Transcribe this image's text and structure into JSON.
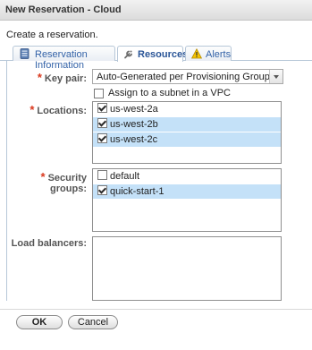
{
  "window": {
    "title": "New Reservation - Cloud"
  },
  "description": "Create a reservation.",
  "tabs": [
    {
      "label": "Reservation Information",
      "icon": "document-icon"
    },
    {
      "label": "Resources",
      "icon": "wrench-icon"
    },
    {
      "label": "Alerts",
      "icon": "warning-icon"
    }
  ],
  "active_tab": "Resources",
  "required_marker": "*",
  "form": {
    "key_pair": {
      "label": "Key pair:",
      "value": "Auto-Generated per Provisioning Group"
    },
    "subnet": {
      "label": "Assign to a subnet in a VPC",
      "checked": false
    },
    "locations": {
      "label": "Locations:",
      "items": [
        {
          "label": "us-west-2a",
          "checked": true,
          "selected": false
        },
        {
          "label": "us-west-2b",
          "checked": true,
          "selected": true
        },
        {
          "label": "us-west-2c",
          "checked": true,
          "selected": true
        }
      ]
    },
    "security_groups": {
      "label": "Security groups:",
      "items": [
        {
          "label": "default",
          "checked": false,
          "selected": false
        },
        {
          "label": "quick-start-1",
          "checked": true,
          "selected": true
        }
      ]
    },
    "load_balancers": {
      "label": "Load balancers:",
      "items": []
    }
  },
  "buttons": {
    "ok": "OK",
    "cancel": "Cancel"
  },
  "colors": {
    "selection": "#c4e1f8",
    "required": "#d9381e",
    "tab_text": "#3463a8",
    "tab_border": "#b7c7d8"
  }
}
